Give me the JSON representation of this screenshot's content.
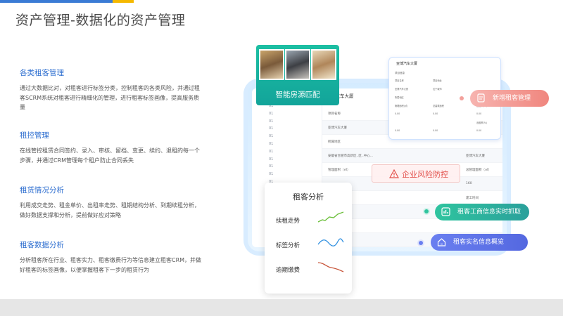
{
  "header": {
    "title": "资产管理-数据化的资产管理"
  },
  "sections": [
    {
      "title": "各类租客管理",
      "body": "通过大数据比对，对租客进行标签分类，控制租客的各类风险，并通过租客SCRM系统对租客进行精细化的管理，进行租客标签画像，提高服务质量"
    },
    {
      "title": "租控管理",
      "body": "在线管控租赁合同签约、录入、审核、留档、变更、续约、退租的每一个步骤，并通过CRM管理每个租户防止合同丢失"
    },
    {
      "title": "租赁情况分析",
      "body": "利用成交走势、租金单价、出租率走势、租期结构分析、到期续租分析，做好数据支撑和分析，提前做好应对策略"
    },
    {
      "title": "租客数据分析",
      "body": "分析租客所在行业、租客实力、租客缴费行为等信息建立租客CRM，并做好租客的标签画像，以便掌握租客下一步的租赁行为"
    }
  ],
  "illustration": {
    "match_label": "智能房源匹配",
    "new_tenant": "新增租客管理",
    "risk_label": "企业风险防控",
    "biz_info": "租客工商信息实时抓取",
    "realname": "租客实名信息概览",
    "analysis": {
      "title": "租客分析",
      "rows": [
        {
          "label": "续租走势",
          "color": "#6bbf3a"
        },
        {
          "label": "标签分析",
          "color": "#2f8fe0"
        },
        {
          "label": "逾期缴费",
          "color": "#c8553a"
        }
      ]
    },
    "tablet": {
      "tree_items": [
        "01",
        "01",
        "01",
        "01",
        "01",
        "01",
        "01",
        "01",
        "01",
        "01",
        "01",
        "01",
        "01",
        "01",
        "01",
        "01",
        "01",
        "01",
        "01"
      ],
      "form_title": "雷汽车大厦",
      "rows": [
        {
          "label": "项目名称",
          "value": ""
        },
        {
          "label": "亚博汽车大厦",
          "value": "亚博汽车大厦"
        },
        {
          "label": "所属地区",
          "value": ""
        },
        {
          "label": "安徽省合肥市高新区..区..中心...",
          "value": "亚博汽车大厦"
        },
        {
          "label": "管理面积（㎡）",
          "value": "总管理面积（㎡）"
        },
        {
          "label": "",
          "value": "160"
        },
        {
          "label": "",
          "value": "建工时间"
        },
        {
          "label": "",
          "value": "物业费"
        },
        {
          "label": "",
          "value": ""
        },
        {
          "label": "",
          "value": "空调费"
        }
      ]
    },
    "detail": {
      "title": "亚博汽车大厦",
      "sub": "项目信息",
      "rows": [
        [
          "项目名称",
          "项目地址"
        ],
        [
          "亚博汽车大厦",
          "位于城市"
        ],
        [
          "所属地区",
          ""
        ],
        [
          "管理面积(㎡)",
          "总建筑面积",
          "出租率(%)"
        ],
        [
          "0.00",
          "0.00",
          "0.00"
        ],
        [
          "",
          "",
          "出租率(%)"
        ],
        [
          "0.00",
          "0.00",
          "0.00"
        ]
      ]
    }
  }
}
